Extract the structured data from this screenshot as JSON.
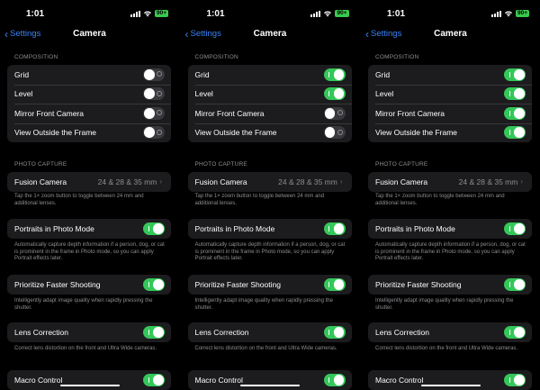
{
  "screens": [
    {
      "status": {
        "time": "1:01",
        "battery": "90+"
      },
      "nav": {
        "back": "Settings",
        "title": "Camera"
      },
      "composition_header": "COMPOSITION",
      "composition": [
        {
          "label": "Grid",
          "on": false
        },
        {
          "label": "Level",
          "on": false
        },
        {
          "label": "Mirror Front Camera",
          "on": false
        },
        {
          "label": "View Outside the Frame",
          "on": false
        }
      ],
      "photo_capture_header": "PHOTO CAPTURE",
      "fusion": {
        "label": "Fusion Camera",
        "value": "24 & 28 & 35 mm"
      },
      "fusion_note": "Tap the 1× zoom button to toggle between 24 mm and additional lenses.",
      "portraits": {
        "label": "Portraits in Photo Mode",
        "on": true
      },
      "portraits_note": "Automatically capture depth information if a person, dog, or cat is prominent in the frame in Photo mode, so you can apply Portrait effects later.",
      "faster": {
        "label": "Prioritize Faster Shooting",
        "on": true
      },
      "faster_note": "Intelligently adapt image quality when rapidly pressing the shutter.",
      "lens": {
        "label": "Lens Correction",
        "on": true
      },
      "lens_note": "Correct lens distortion on the front and Ultra Wide cameras.",
      "macro": {
        "label": "Macro Control",
        "on": true
      }
    },
    {
      "status": {
        "time": "1:01",
        "battery": "90+"
      },
      "nav": {
        "back": "Settings",
        "title": "Camera"
      },
      "composition_header": "COMPOSITION",
      "composition": [
        {
          "label": "Grid",
          "on": true
        },
        {
          "label": "Level",
          "on": true
        },
        {
          "label": "Mirror Front Camera",
          "on": false
        },
        {
          "label": "View Outside the Frame",
          "on": false
        }
      ],
      "photo_capture_header": "PHOTO CAPTURE",
      "fusion": {
        "label": "Fusion Camera",
        "value": "24 & 28 & 35 mm"
      },
      "fusion_note": "Tap the 1× zoom button to toggle between 24 mm and additional lenses.",
      "portraits": {
        "label": "Portraits in Photo Mode",
        "on": true
      },
      "portraits_note": "Automatically capture depth information if a person, dog, or cat is prominent in the frame in Photo mode, so you can apply Portrait effects later.",
      "faster": {
        "label": "Prioritize Faster Shooting",
        "on": true
      },
      "faster_note": "Intelligently adapt image quality when rapidly pressing the shutter.",
      "lens": {
        "label": "Lens Correction",
        "on": true
      },
      "lens_note": "Correct lens distortion on the front and Ultra Wide cameras.",
      "macro": {
        "label": "Macro Control",
        "on": true
      }
    },
    {
      "status": {
        "time": "1:01",
        "battery": "90+"
      },
      "nav": {
        "back": "Settings",
        "title": "Camera"
      },
      "composition_header": "COMPOSITION",
      "composition": [
        {
          "label": "Grid",
          "on": true
        },
        {
          "label": "Level",
          "on": true
        },
        {
          "label": "Mirror Front Camera",
          "on": true
        },
        {
          "label": "View Outside the Frame",
          "on": true
        }
      ],
      "photo_capture_header": "PHOTO CAPTURE",
      "fusion": {
        "label": "Fusion Camera",
        "value": "24 & 28 & 35 mm"
      },
      "fusion_note": "Tap the 1× zoom button to toggle between 24 mm and additional lenses.",
      "portraits": {
        "label": "Portraits in Photo Mode",
        "on": true
      },
      "portraits_note": "Automatically capture depth information if a person, dog, or cat is prominent in the frame in Photo mode, so you can apply Portrait effects later.",
      "faster": {
        "label": "Prioritize Faster Shooting",
        "on": true
      },
      "faster_note": "Intelligently adapt image quality when rapidly pressing the shutter.",
      "lens": {
        "label": "Lens Correction",
        "on": true
      },
      "lens_note": "Correct lens distortion on the front and Ultra Wide cameras.",
      "macro": {
        "label": "Macro Control",
        "on": true
      }
    }
  ],
  "colors": {
    "accent": "#3b82f6",
    "toggle_on": "#34c759",
    "toggle_off": "#39393d",
    "cell_bg": "#1c1c1e",
    "secondary_text": "#8e8e93"
  }
}
